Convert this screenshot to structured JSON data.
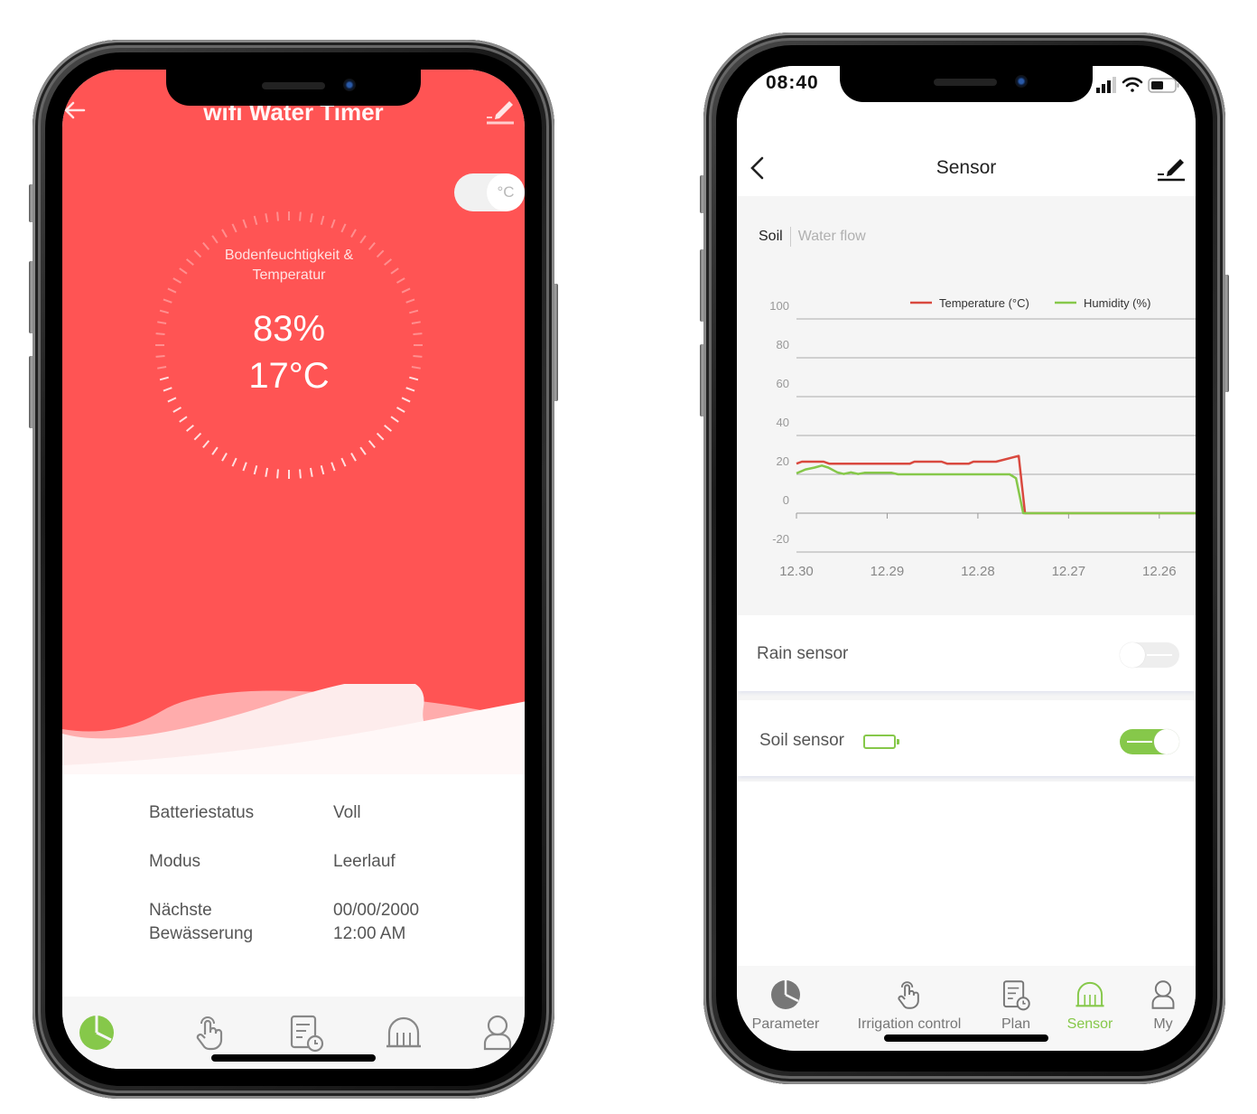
{
  "left_phone": {
    "header": {
      "title": "wifi Water Timer",
      "back_icon": "arrow-left-icon",
      "edit_icon": "edit-pencil-icon"
    },
    "unit_toggle": {
      "label": "°C"
    },
    "gauge": {
      "label_line1": "Bodenfeuchtigkeit &",
      "label_line2": "Temperatur",
      "humidity": "83%",
      "temperature": "17°C"
    },
    "info": [
      {
        "key": "Batteriestatus",
        "value": "Voll"
      },
      {
        "key": "Modus",
        "value": "Leerlauf"
      },
      {
        "key": "Nächste Bewässerung",
        "key_line1": "Nächste",
        "key_line2": "Bewässerung",
        "value_line1": "00/00/2000",
        "value_line2": "12:00 AM"
      }
    ],
    "tabs": [
      {
        "icon": "pie-chart-icon",
        "active": true
      },
      {
        "icon": "hand-tap-icon",
        "active": false
      },
      {
        "icon": "plan-schedule-icon",
        "active": false
      },
      {
        "icon": "sensor-dome-icon",
        "active": false
      },
      {
        "icon": "user-icon",
        "active": false
      }
    ],
    "colors": {
      "primary": "#ff5454",
      "accent": "#86c84a"
    }
  },
  "right_phone": {
    "status_bar": {
      "time": "08:40"
    },
    "nav": {
      "title": "Sensor"
    },
    "segments": {
      "active": "Soil",
      "inactive": "Water flow"
    },
    "rain_sensor": {
      "label": "Rain sensor",
      "enabled": false
    },
    "soil_sensor": {
      "label": "Soil sensor",
      "enabled": true,
      "battery": "battery-icon"
    },
    "tabs": [
      {
        "label": "Parameter",
        "icon": "pie-chart-icon",
        "active": false
      },
      {
        "label": "Irrigation control",
        "icon": "hand-tap-icon",
        "active": false
      },
      {
        "label": "Plan",
        "icon": "plan-schedule-icon",
        "active": false
      },
      {
        "label": "Sensor",
        "icon": "sensor-dome-icon",
        "active": true
      },
      {
        "label": "My",
        "icon": "user-icon",
        "active": false
      }
    ],
    "colors": {
      "accent": "#86c84a",
      "temperature": "#d9493f",
      "humidity": "#86c84a"
    }
  },
  "chart_data": {
    "type": "line",
    "title": "",
    "xlabel": "",
    "ylabel": "",
    "legend_position": "top-right",
    "grid": true,
    "x_tick_labels": [
      "12.30",
      "12.29",
      "12.28",
      "12.27",
      "12.26"
    ],
    "x_ticks": [
      0,
      1,
      2,
      3,
      4
    ],
    "xlim": [
      0,
      4.4
    ],
    "y_tick_labels": [
      "100",
      "80",
      "60",
      "40",
      "20",
      "0",
      "-20"
    ],
    "y_ticks": [
      100,
      80,
      60,
      40,
      20,
      0,
      -20
    ],
    "ylim": [
      -20,
      100
    ],
    "series": [
      {
        "name": "Temperature (°C)",
        "color": "#d9493f",
        "points": [
          [
            0,
            25.5
          ],
          [
            0.06,
            26.5
          ],
          [
            0.3,
            26.5
          ],
          [
            0.36,
            25.5
          ],
          [
            1.25,
            25.5
          ],
          [
            1.3,
            26.5
          ],
          [
            1.6,
            26.5
          ],
          [
            1.66,
            25.5
          ],
          [
            1.9,
            25.5
          ],
          [
            1.95,
            26.5
          ],
          [
            2.2,
            26.5
          ],
          [
            2.45,
            29.5
          ],
          [
            2.52,
            0
          ],
          [
            4.4,
            0
          ]
        ]
      },
      {
        "name": "Humidity (%)",
        "color": "#86c84a",
        "points": [
          [
            0,
            20.5
          ],
          [
            0.1,
            22.5
          ],
          [
            0.2,
            23.5
          ],
          [
            0.28,
            24.5
          ],
          [
            0.35,
            23.5
          ],
          [
            0.45,
            21
          ],
          [
            0.52,
            20.2
          ],
          [
            0.6,
            21
          ],
          [
            0.68,
            20.2
          ],
          [
            0.75,
            20.8
          ],
          [
            1.05,
            20.8
          ],
          [
            1.12,
            20
          ],
          [
            2.35,
            20
          ],
          [
            2.42,
            18
          ],
          [
            2.5,
            0
          ],
          [
            4.4,
            0
          ]
        ]
      }
    ]
  }
}
